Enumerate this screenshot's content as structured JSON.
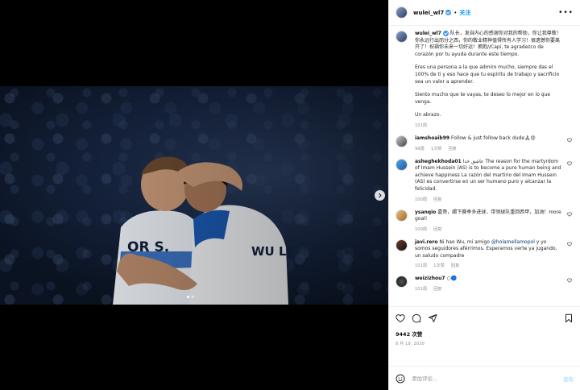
{
  "post": {
    "username": "wulei_wl7",
    "follow_label": "关注",
    "separator": "•",
    "more_label": "•••",
    "caption_lines": [
      "队长，发自内心的感谢你对我的帮助，你让我尊敬！你永远行出而分之西，你的敬业精神值得所有人学习！很遗憾你要离开了！祝福你未来一切好运！拥抱//Capi, te agradezco de corazón por tu ayuda durante este tiempo.",
      "Eres una persona a la que admiro mucho, siempre das el 100% de ti y eso hace que tu espíritu de trabajo y sacrificio sea un valor a aprender.",
      "Siento mucho que te vayas, te deseo lo mejor en lo que venga.",
      "Un abrazo."
    ],
    "caption_time": "101周",
    "likes": "9442 次赞",
    "date": "8 月 19, 2020",
    "image_alt_text_1": "OR S.",
    "image_alt_text_2": "WU LE"
  },
  "comments": [
    {
      "user": "iamshoaib99",
      "text": "Follow & just follow back dude🙏🏽😍",
      "time": "99周",
      "likes": "1次赞",
      "reply": "回复"
    },
    {
      "user": "asheghekhoda01",
      "text": "عاشق خدا The reason for the martyrdom of Imam Hussein (AS) is to become a pure human being and achieve happiness La razón del martirio del Imam Hussein (AS) es convertirse en un ser humano puro y alcanzar la felicidad.",
      "time": "100周",
      "likes": "",
      "reply": "回复"
    },
    {
      "user": "ysanqio",
      "text": "嘉哥，踢下赛季多进球，带领球队重回西甲，加油！more goal!",
      "time": "100周",
      "likes": "",
      "reply": "回复"
    },
    {
      "user": "javi.rero",
      "text_before": "Ni hao Wu, mi amigo ",
      "mention": "@holamellamopol",
      "text_after": " y yo somos seguidores aférrimos. Esperamos verte ya jugando, un saludo compadre",
      "time": "101周",
      "likes": "1次赞",
      "reply": "回复"
    },
    {
      "user": "weizizhou7",
      "text": "○🔵",
      "time": "101周",
      "likes": "",
      "reply": "回复"
    }
  ],
  "add_comment": {
    "placeholder": "添加评论...",
    "post_label": "发布"
  },
  "icons": {
    "heart": "heart-icon",
    "comment": "comment-icon",
    "share": "share-icon",
    "save": "bookmark-icon",
    "emoji": "emoji-icon",
    "next": "chevron-right-icon",
    "more": "more-icon"
  },
  "colors": {
    "accent": "#0095f6",
    "verified": "#3897f0",
    "jersey_blue": "#1c5ab4"
  }
}
